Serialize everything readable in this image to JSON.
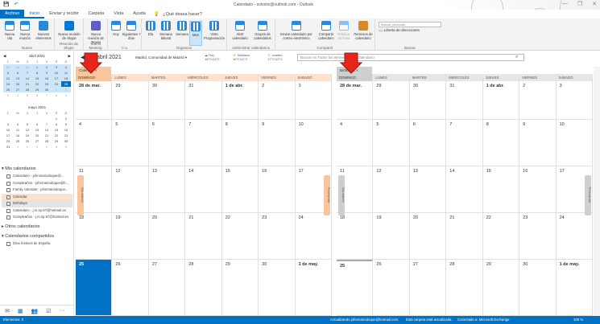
{
  "window": {
    "title": "Calendario - solvetic@outlook.com - Outlook",
    "controls": [
      "—",
      "❐",
      "✕"
    ]
  },
  "ribbon_tabs": [
    "Archivo",
    "Inicio",
    "Enviar y recibir",
    "Carpeta",
    "Vista",
    "Ayuda"
  ],
  "tell_me": "¿Qué desea hacer?",
  "ribbon": {
    "new_group": {
      "label": "Nuevo",
      "buttons": [
        "Nueva cita",
        "Nueva reunión",
        "Nuevos elementos"
      ]
    },
    "skype_group": {
      "label": "Reunión de Skype",
      "buttons": [
        "Nueva reunión de Skype"
      ]
    },
    "teams_group": {
      "label": "Teams Meeting",
      "buttons": [
        "Nueva reunión de Teams"
      ]
    },
    "goto_group": {
      "label": "Ir a",
      "buttons": [
        "Hoy",
        "Siguientes 7 días"
      ]
    },
    "arrange_group": {
      "label": "Organizar",
      "buttons": [
        "Día",
        "Semana laboral",
        "Semana",
        "Mes",
        "Vista Programación"
      ]
    },
    "manage_group": {
      "label": "Administrar calendarios",
      "buttons": [
        "Abrir calendario",
        "Grupos de calendarios"
      ]
    },
    "share_group": {
      "label": "Compartir",
      "buttons": [
        "Enviar calendario por correo electrónico",
        "Compartir calendario",
        "Publicar en línea",
        "Permisos de calendario"
      ]
    },
    "find_group": {
      "label": "Buscar",
      "search_placeholder": "Buscar personas",
      "address_book": "Libreta de direcciones"
    }
  },
  "minicals": [
    {
      "title": "abril 2021",
      "dow": [
        "L",
        "M",
        "X",
        "J",
        "V",
        "S",
        "D"
      ],
      "weeks": [
        [
          "29",
          "30",
          "31",
          "1",
          "2",
          "3",
          "4"
        ],
        [
          "5",
          "6",
          "7",
          "8",
          "9",
          "10",
          "11"
        ],
        [
          "12",
          "13",
          "14",
          "15",
          "16",
          "17",
          "18"
        ],
        [
          "19",
          "20",
          "21",
          "22",
          "23",
          "24",
          "25"
        ],
        [
          "26",
          "27",
          "28",
          "29",
          "30",
          "1",
          "2"
        ],
        [
          "3",
          "4",
          "5",
          "6",
          "7",
          "8",
          "9"
        ]
      ]
    },
    {
      "title": "mayo 2021",
      "dow": [
        "L",
        "M",
        "X",
        "J",
        "V",
        "S",
        "D"
      ],
      "weeks": [
        [
          "",
          "",
          "",
          "",
          "",
          "1",
          "2"
        ],
        [
          "3",
          "4",
          "5",
          "6",
          "7",
          "8",
          "9"
        ],
        [
          "10",
          "11",
          "12",
          "13",
          "14",
          "15",
          "16"
        ],
        [
          "17",
          "18",
          "19",
          "20",
          "21",
          "22",
          "23"
        ],
        [
          "24",
          "25",
          "26",
          "27",
          "28",
          "29",
          "30"
        ],
        [
          "31",
          "1",
          "2",
          "3",
          "4",
          "5",
          "6"
        ]
      ]
    }
  ],
  "folders": {
    "my_calendars": "Mis calendarios",
    "my_items": [
      {
        "label": "Calendario - johnmariodoque@...",
        "checked": false
      },
      {
        "label": "Cumpleaños - johnmariodoque@h...",
        "checked": false
      },
      {
        "label": "Family calendar - johnmariodoque...",
        "checked": false
      },
      {
        "label": "Calendar",
        "checked": true
      },
      {
        "label": "Birthdays",
        "checked": true
      },
      {
        "label": "Calendario - j.m.sp.87@hotmail.es",
        "checked": false
      },
      {
        "label": "Cumpleaños - j.m.sp.87@hotmail.es",
        "checked": false
      }
    ],
    "other_calendars": "Otros calendarios",
    "shared_calendars": "Calendarios compartidos",
    "shared_items": [
      {
        "label": "Días festivos de España",
        "checked": false
      }
    ]
  },
  "calbar": {
    "month": "abril 2021",
    "location": "Madrid, Comunidad de Madrid",
    "weather": [
      {
        "day": "Hoy",
        "temp": "16°C/11°C"
      },
      {
        "day": "Mañana",
        "temp": "16°C/11°C"
      },
      {
        "day": "martes",
        "temp": "17°C/12°C"
      }
    ],
    "search_placeholder": "Buscar en Todos los elementos de Calendario"
  },
  "panes": [
    {
      "tab": "Calendar",
      "days": [
        "DOMINGO",
        "LUNES",
        "MARTES",
        "MIÉRCOLES",
        "JUEVES",
        "VIERNES",
        "SÁBADO"
      ],
      "weeks": [
        [
          "28 de mar.",
          "29",
          "30",
          "31",
          "1 de abr.",
          "2",
          "3"
        ],
        [
          "4",
          "5",
          "6",
          "7",
          "8",
          "9",
          "10"
        ],
        [
          "11",
          "12",
          "13",
          "14",
          "15",
          "16",
          "17"
        ],
        [
          "18",
          "19",
          "20",
          "21",
          "22",
          "23",
          "24"
        ],
        [
          "25",
          "26",
          "27",
          "28",
          "29",
          "30",
          "1 de may."
        ]
      ],
      "prev_tab": "Cita anterior",
      "next_tab": "Próxima cita"
    },
    {
      "tab": "Birthdays",
      "days": [
        "DOMINGO",
        "LUNES",
        "MARTES",
        "MIÉRCOLES",
        "JUEVES",
        "VIERNES",
        "SÁBADO"
      ],
      "weeks": [
        [
          "28 de mar.",
          "29",
          "30",
          "31",
          "1 de abr.",
          "2",
          "3"
        ],
        [
          "4",
          "5",
          "6",
          "7",
          "8",
          "9",
          "10"
        ],
        [
          "11",
          "12",
          "13",
          "14",
          "15",
          "16",
          "17"
        ],
        [
          "18",
          "19",
          "20",
          "21",
          "22",
          "23",
          "24"
        ],
        [
          "25",
          "26",
          "27",
          "28",
          "29",
          "30",
          "1 de may."
        ]
      ],
      "prev_tab": "Cita anterior",
      "next_tab": "Próxima cita"
    }
  ],
  "status": {
    "items": "Elementos: 0",
    "updating": "Actualizando johnmariodoque@hotmail.com.",
    "folder_status": "Esta carpeta está actualizada.",
    "connected": "Conectado a: Microsoft Exchange",
    "zoom": "100 %"
  },
  "colors": {
    "accent": "#0072c6",
    "calendar_tab": "#f9c59d",
    "birthdays_tab": "#cfcfcf",
    "arrow": "#e8251b"
  }
}
